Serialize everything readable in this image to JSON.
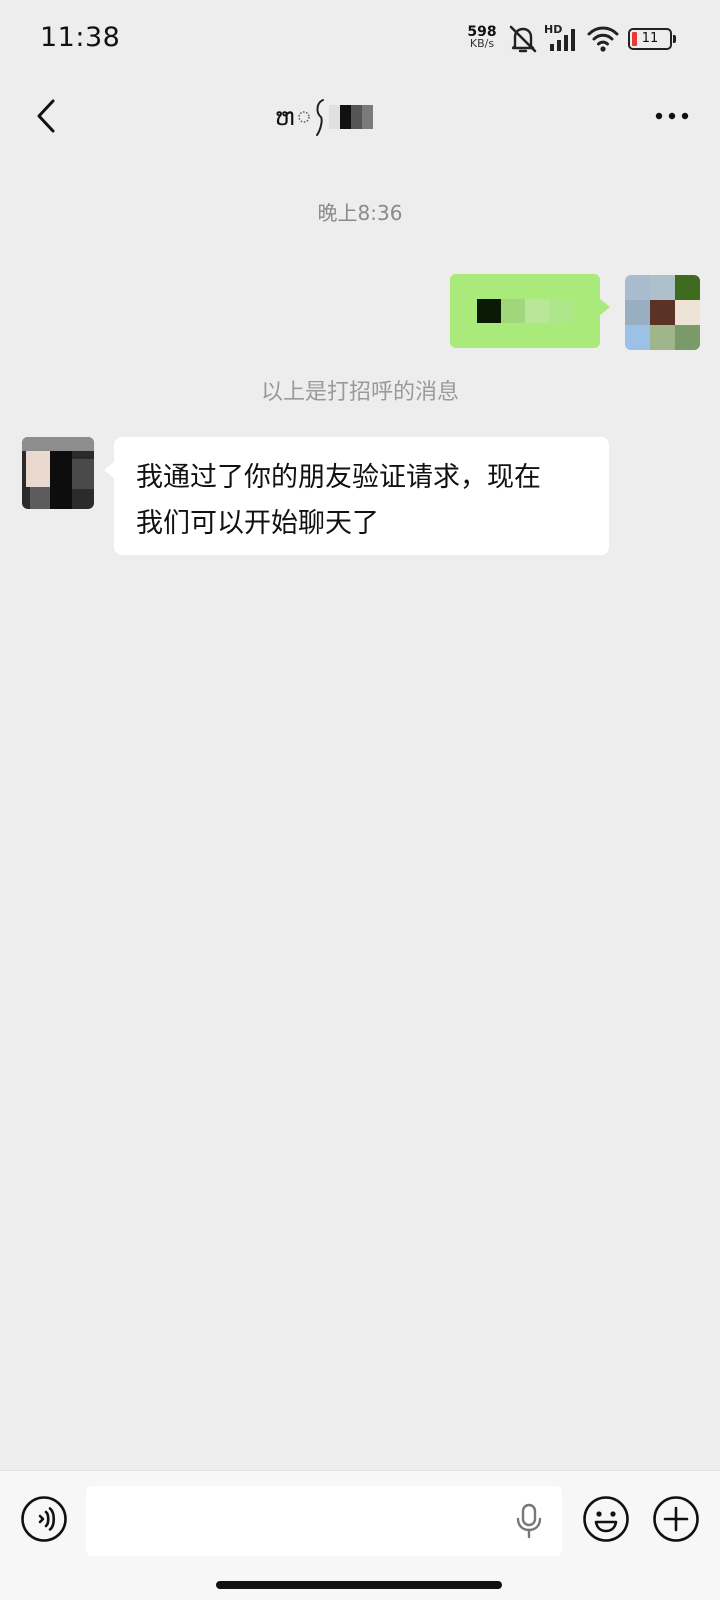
{
  "status_bar": {
    "time": "11:38",
    "net_speed_value": "598",
    "net_speed_unit": "KB/s",
    "battery_level": "11",
    "icons": [
      "mute-bell-icon",
      "hd-signal-icon",
      "wifi-icon",
      "battery-icon"
    ]
  },
  "chat": {
    "title_visible": "ຫ",
    "title_note": "contact name partially pixelated",
    "timestamp": "晚上8:36",
    "greeting_note": "以上是打招呼的消息",
    "received_message": {
      "line1": "我通过了你的朋友验证请求，现在",
      "line2": "我们可以开始聊天了"
    }
  },
  "input_bar": {
    "text_value": "",
    "placeholder": ""
  },
  "colors": {
    "background": "#ededed",
    "sent_bubble": "#a9ea7a",
    "received_bubble": "#ffffff",
    "battery_low": "#e53935"
  }
}
